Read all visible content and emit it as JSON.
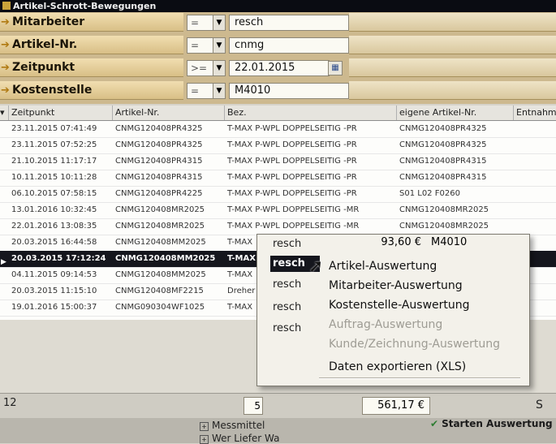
{
  "window": {
    "title": "Artikel-Schrott-Bewegungen"
  },
  "filters": [
    {
      "label": "Mitarbeiter",
      "operator": "=",
      "value": "resch"
    },
    {
      "label": "Artikel-Nr.",
      "operator": "=",
      "value": "cnmg"
    },
    {
      "label": "Zeitpunkt",
      "operator": ">=",
      "value": "22.01.2015"
    },
    {
      "label": "Kostenstelle",
      "operator": "=",
      "value": "M4010"
    }
  ],
  "grid": {
    "columns": [
      "Zeitpunkt",
      "Artikel-Nr.",
      "Bez.",
      "eigene Artikel-Nr.",
      "Entnahme"
    ],
    "rows": [
      [
        "23.11.2015 07:41:49",
        "CNMG120408PR4325",
        "T-MAX P-WPL DOPPELSEITIG -PR",
        "CNMG120408PR4325"
      ],
      [
        "23.11.2015 07:52:25",
        "CNMG120408PR4325",
        "T-MAX P-WPL DOPPELSEITIG -PR",
        "CNMG120408PR4325"
      ],
      [
        "21.10.2015 11:17:17",
        "CNMG120408PR4315",
        "T-MAX P-WPL DOPPELSEITIG -PR",
        "CNMG120408PR4315"
      ],
      [
        "10.11.2015 10:11:28",
        "CNMG120408PR4315",
        "T-MAX P-WPL DOPPELSEITIG -PR",
        "CNMG120408PR4315"
      ],
      [
        "06.10.2015 07:58:15",
        "CNMG120408PR4225",
        "T-MAX P-WPL DOPPELSEITIG -PR",
        "S01 L02 F0260"
      ],
      [
        "13.01.2016 10:32:45",
        "CNMG120408MR2025",
        "T-MAX P-WPL DOPPELSEITIG -MR",
        "CNMG120408MR2025"
      ],
      [
        "22.01.2016 13:08:35",
        "CNMG120408MR2025",
        "T-MAX P-WPL DOPPELSEITIG -MR",
        "CNMG120408MR2025"
      ],
      [
        "20.03.2015 16:44:58",
        "CNMG120408MM2025",
        "T-MAX",
        ""
      ],
      [
        "20.03.2015 17:12:24",
        "CNMG120408MM2025",
        "T-MAX",
        ""
      ],
      [
        "04.11.2015 09:14:53",
        "CNMG120408MM2025",
        "T-MAX",
        ""
      ],
      [
        "20.03.2015 11:15:10",
        "CNMG120408MF2215",
        "Dreher",
        ""
      ],
      [
        "19.01.2016 15:00:37",
        "CNMG090304WF1025",
        "T-MAX",
        ""
      ]
    ],
    "selected_row": 8
  },
  "popup": {
    "names": [
      "resch",
      "resch",
      "resch",
      "resch",
      "resch"
    ],
    "first_row": {
      "amount": "93,60 €",
      "code": "M4010"
    },
    "menu": [
      {
        "label": "Artikel-Auswertung",
        "enabled": true
      },
      {
        "label": "Mitarbeiter-Auswertung",
        "enabled": true
      },
      {
        "label": "Kostenstelle-Auswertung",
        "enabled": true
      },
      {
        "label": "Auftrag-Auswertung",
        "enabled": false
      },
      {
        "label": "Kunde/Zeichnung-Auswertung",
        "enabled": false
      },
      {
        "label": "Daten exportieren (XLS)",
        "enabled": true
      }
    ]
  },
  "status": {
    "count": "12",
    "sum_left": "5",
    "sum_total": "561,17 €",
    "right_glyph": "S"
  },
  "bottom": {
    "tree_item_1": "Messmittel",
    "tree_item_2": "Wer Liefer Wa",
    "start_label": "Starten Auswertung"
  }
}
